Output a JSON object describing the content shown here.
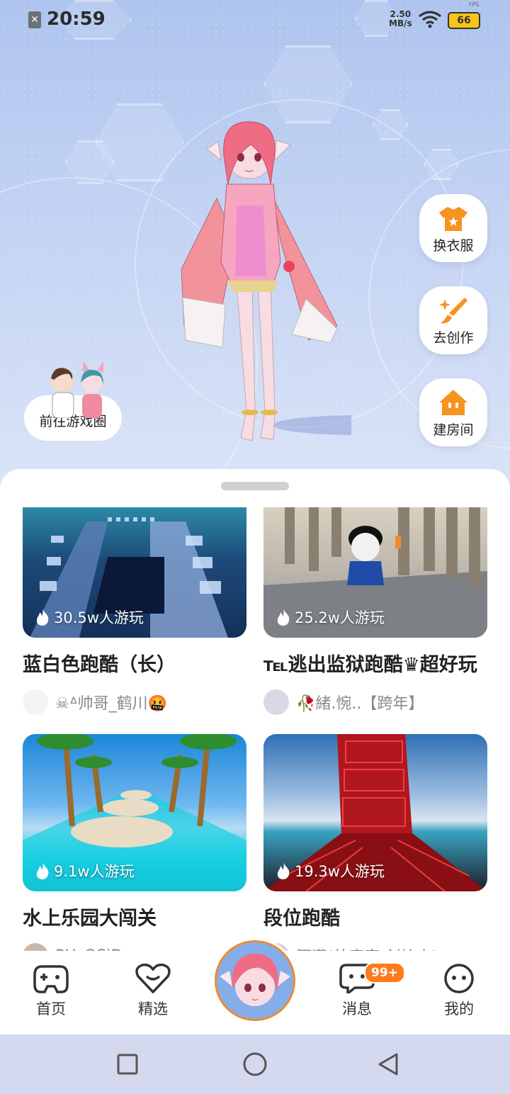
{
  "status_bar": {
    "time": "20:59",
    "net_speed_value": "2.50",
    "net_speed_unit": "MB/s",
    "battery": "66",
    "fps_label": "FPS"
  },
  "side_actions": [
    {
      "label": "换衣服",
      "icon": "shirt-icon"
    },
    {
      "label": "去创作",
      "icon": "brush-icon"
    },
    {
      "label": "建房间",
      "icon": "house-icon"
    }
  ],
  "game_circle": {
    "label": "前往游戏圈"
  },
  "games": [
    {
      "title": "蓝白色跑酷（长）",
      "plays": "30.5w人游玩",
      "author": "☠ᐞ帅哥_鹤川🤬"
    },
    {
      "title": "℡逃出监狱跑酷♛超好玩",
      "plays": "25.2w人游玩",
      "author": "🥀緒.惋..【跨年】"
    },
    {
      "title": "水上乐园大闯关",
      "plays": "9.1w人游玩",
      "author": "PH_OSiD"
    },
    {
      "title": "段位跑酷",
      "plays": "19.3w人游玩",
      "author": "阿潇(外音家 创始人)"
    }
  ],
  "nav": {
    "home": "首页",
    "featured": "精选",
    "messages": "消息",
    "messages_badge": "99+",
    "me": "我的"
  },
  "colors": {
    "accent": "#f7931e",
    "hero_bg": "#b5c8f0"
  }
}
